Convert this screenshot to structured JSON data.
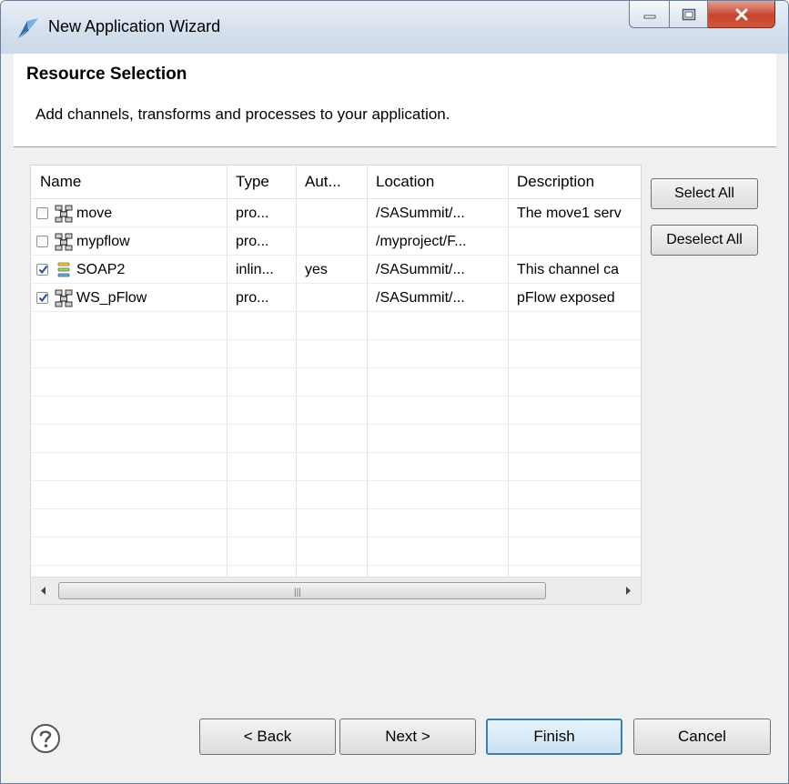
{
  "window": {
    "title": "New Application Wizard"
  },
  "header": {
    "title": "Resource Selection",
    "description": "Add channels, transforms and processes to your application."
  },
  "table": {
    "columns": [
      "Name",
      "Type",
      "Aut...",
      "Location",
      "Description"
    ],
    "rows": [
      {
        "checked": false,
        "icon": "process-icon",
        "name": "move",
        "type": "pro...",
        "auto": "",
        "location": "/SASummit/...",
        "description": "The move1 serv"
      },
      {
        "checked": false,
        "icon": "process-icon",
        "name": "mypflow",
        "type": "pro...",
        "auto": "",
        "location": "/myproject/F...",
        "description": ""
      },
      {
        "checked": true,
        "icon": "channel-icon",
        "name": "SOAP2",
        "type": "inlin...",
        "auto": "yes",
        "location": "/SASummit/...",
        "description": "This channel ca"
      },
      {
        "checked": true,
        "icon": "process-icon",
        "name": "WS_pFlow",
        "type": "pro...",
        "auto": "",
        "location": "/SASummit/...",
        "description": "pFlow exposed"
      }
    ]
  },
  "side_buttons": {
    "select_all": "Select All",
    "deselect_all": "Deselect All"
  },
  "footer": {
    "back": "< Back",
    "next": "Next >",
    "finish": "Finish",
    "cancel": "Cancel"
  }
}
